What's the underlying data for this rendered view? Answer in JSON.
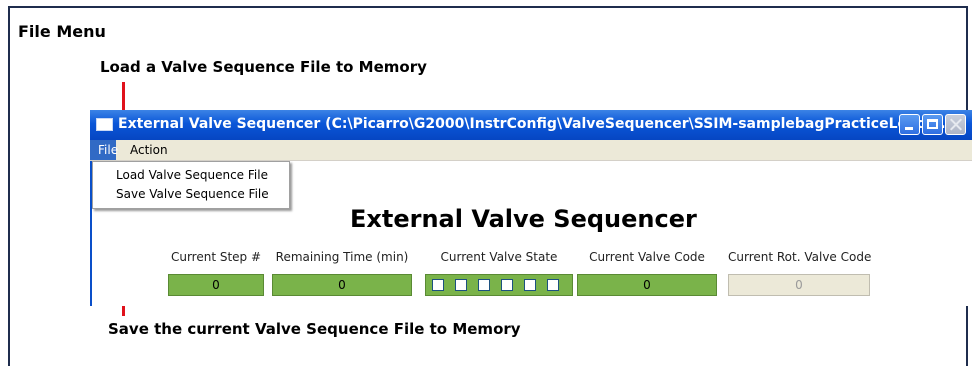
{
  "heading": "File Menu",
  "annotations": {
    "load": "Load a Valve Sequence File to Memory",
    "save": "Save the current Valve Sequence File to Memory"
  },
  "window": {
    "title": "External Valve Sequencer  (C:\\Picarro\\G2000\\InstrConfig\\ValveSequencer\\SSIM-samplebagPracticeLoad.s...",
    "menu": [
      "File",
      "Action"
    ],
    "file_menu": [
      "Load Valve Sequence File",
      "Save Valve Sequence File"
    ],
    "app_title": "External Valve Sequencer",
    "fields": [
      {
        "label": "Current Step #",
        "value": "0"
      },
      {
        "label": "Remaining Time (min)",
        "value": "0"
      },
      {
        "label": "Current Valve State",
        "valves": [
          false,
          false,
          false,
          false,
          false,
          false
        ]
      },
      {
        "label": "Current Valve Code",
        "value": "0"
      },
      {
        "label": "Current Rot. Valve Code",
        "value": "0",
        "disabled": true
      }
    ]
  },
  "colors": {
    "frame": "#1f2d4d",
    "arrow": "#e0111b",
    "titlebar": "#0a56d8",
    "field_green": "#7ab34a",
    "menu_highlight": "#316ac5"
  },
  "icons": [
    "window-app-icon",
    "minimize-icon",
    "maximize-icon",
    "close-icon"
  ]
}
